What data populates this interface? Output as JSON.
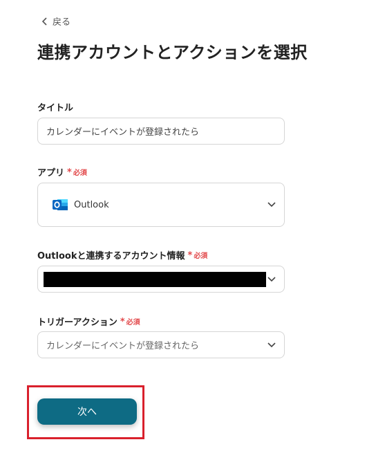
{
  "header": {
    "back_label": "戻る",
    "page_title": "連携アカウントとアクションを選択"
  },
  "form": {
    "title_field": {
      "label": "タイトル",
      "value": "カレンダーにイベントが登録されたら"
    },
    "app_field": {
      "label": "アプリ",
      "required": "必須",
      "selected_app": "Outlook",
      "icon": "outlook-icon"
    },
    "account_field": {
      "label": "Outlookと連携するアカウント情報",
      "required": "必須"
    },
    "trigger_field": {
      "label": "トリガーアクション",
      "required": "必須",
      "selected": "カレンダーにイベントが登録されたら"
    }
  },
  "footer": {
    "next_label": "次へ"
  },
  "colors": {
    "primary": "#0e6b84",
    "required": "#e2494b",
    "highlight": "#d9202c"
  }
}
